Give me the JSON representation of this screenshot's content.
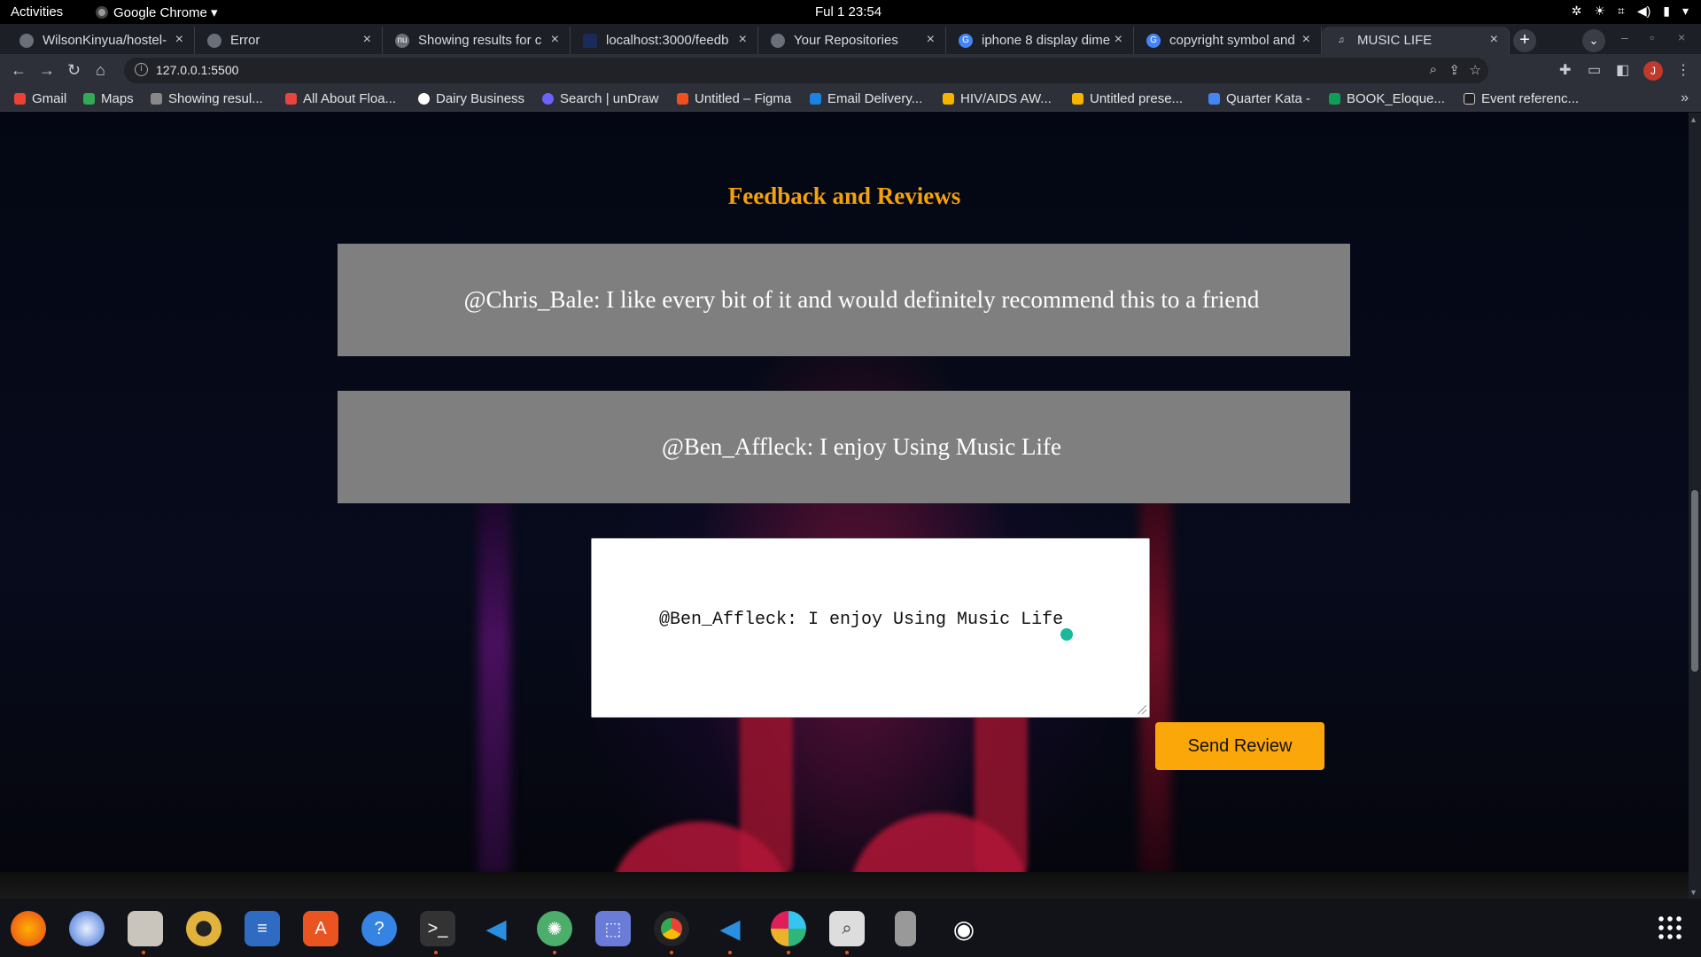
{
  "topbar": {
    "activities": "Activities",
    "app_name": "Google Chrome ▾",
    "clock": "Ful 1  23:54"
  },
  "tabs": [
    {
      "label": "WilsonKinyua/hostel-",
      "icon": "github-icon"
    },
    {
      "label": "Error",
      "icon": "chrome-icon"
    },
    {
      "label": "Showing results for c",
      "icon": "nu-icon"
    },
    {
      "label": "localhost:3000/feedb",
      "icon": "page-icon"
    },
    {
      "label": "Your Repositories",
      "icon": "github-icon"
    },
    {
      "label": "iphone 8 display dime",
      "icon": "google-icon"
    },
    {
      "label": "copyright symbol and",
      "icon": "google-icon"
    },
    {
      "label": "MUSIC LIFE",
      "icon": "music-note-icon",
      "active": true
    }
  ],
  "toolbar": {
    "url": "127.0.0.1:5500",
    "profile_initial": "J"
  },
  "bookmarks": [
    {
      "label": "Gmail",
      "color": "#ea4335"
    },
    {
      "label": "Maps",
      "color": "#34a853"
    },
    {
      "label": "Showing resul...",
      "color": "#888888"
    },
    {
      "label": "All About Floa...",
      "color": "#e8453c"
    },
    {
      "label": "Dairy Business",
      "color": "#ffffff"
    },
    {
      "label": "Search | unDraw",
      "color": "#6c63ff"
    },
    {
      "label": "Untitled – Figma",
      "color": "#f24e1e"
    },
    {
      "label": "Email Delivery...",
      "color": "#1a82e2"
    },
    {
      "label": "HIV/AIDS AW...",
      "color": "#f4b400"
    },
    {
      "label": "Untitled prese...",
      "color": "#f4b400"
    },
    {
      "label": "Quarter Kata -",
      "color": "#4285f4"
    },
    {
      "label": "BOOK_Eloque...",
      "color": "#0f9d58"
    },
    {
      "label": "Event referenc...",
      "color": "#222222"
    }
  ],
  "page": {
    "title": "Feedback and Reviews",
    "reviews": [
      "@Chris_Bale: I like every bit of it and would definitely recommend this to a friend",
      "@Ben_Affleck: I enjoy Using Music Life"
    ],
    "textarea_value": "@Ben_Affleck: I enjoy Using Music Life",
    "send_button": "Send Review"
  },
  "colors": {
    "accent": "#f5a10a",
    "button": "#fca709",
    "review_bg": "#7f7f7f"
  },
  "dock": [
    "firefox-icon",
    "thunderbird-icon",
    "files-icon",
    "rhythmbox-icon",
    "writer-icon",
    "software-icon",
    "help-icon",
    "terminal-icon",
    "vscode-icon",
    "atom-icon",
    "screenshot-icon",
    "chrome-icon",
    "vscode-icon",
    "slack-icon",
    "image-viewer-icon",
    "device-icon",
    "camera-icon"
  ]
}
